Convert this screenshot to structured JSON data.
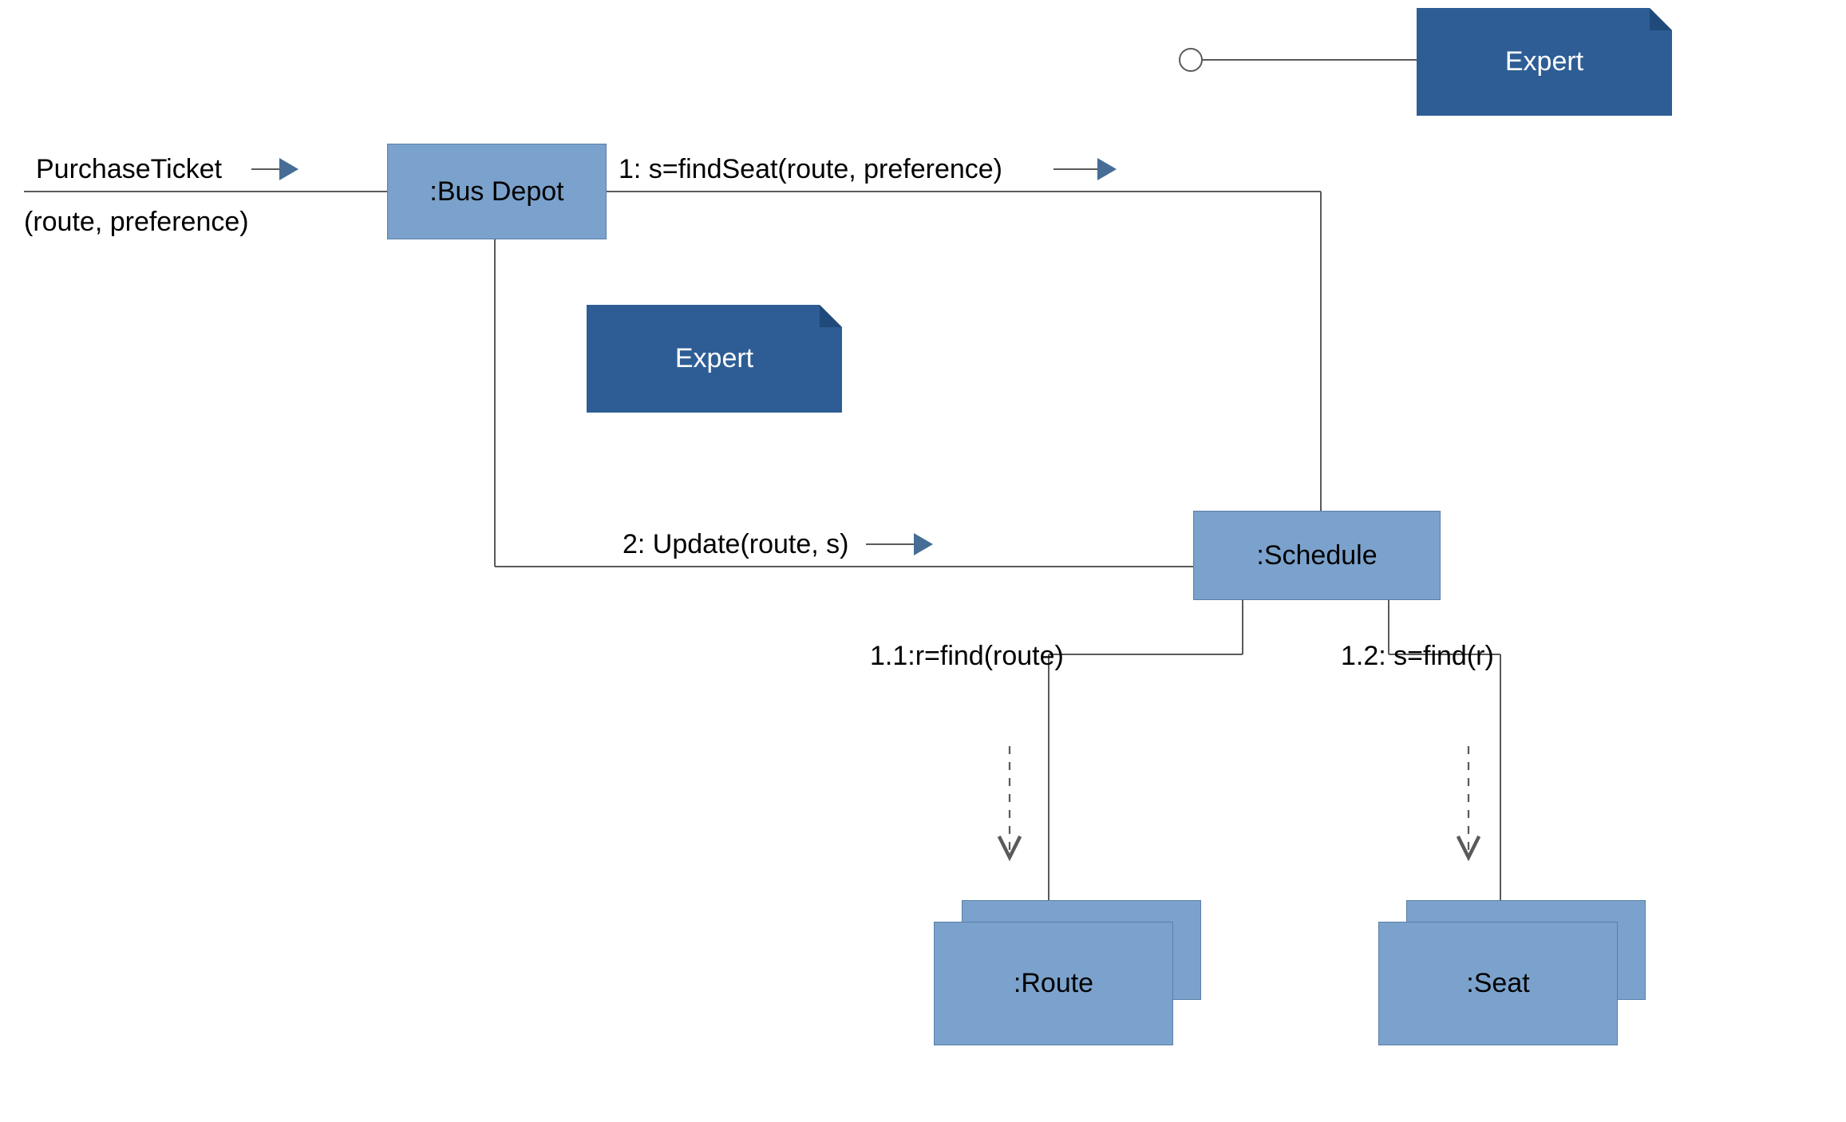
{
  "messages": {
    "purchase_upper": "PurchaseTicket",
    "purchase_lower": "(route, preference)",
    "msg1": "1: s=findSeat(route, preference)",
    "msg2": "2: Update(route, s)",
    "msg11": "1.1:r=find(route)",
    "msg12": "1.2: s=find(r)"
  },
  "objects": {
    "bus_depot": ":Bus Depot",
    "schedule": ":Schedule",
    "route": ":Route",
    "seat": ":Seat"
  },
  "notes": {
    "expert_center": "Expert",
    "expert_top": "Expert"
  },
  "colors": {
    "light_box": "#7ba2cc",
    "light_box_border": "#5a7fa8",
    "note_bg": "#2d5d94",
    "arrow_fill": "#456d95",
    "line_gray": "#5a5a5a"
  }
}
